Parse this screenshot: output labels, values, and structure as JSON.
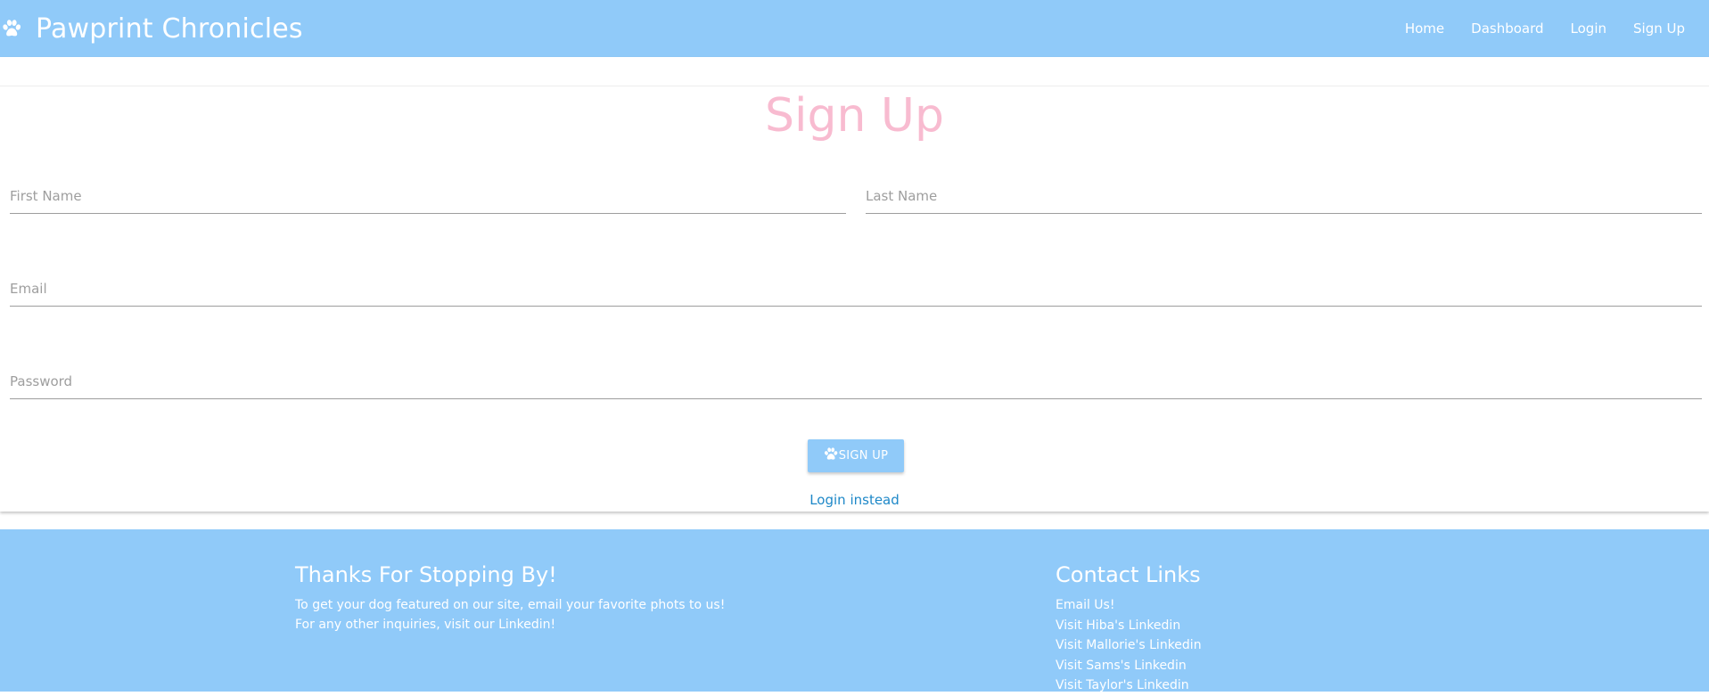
{
  "navbar": {
    "brand_icon": "paw-icon",
    "brand_title": "Pawprint Chronicles",
    "links": [
      {
        "label": "Home"
      },
      {
        "label": "Dashboard"
      },
      {
        "label": "Login"
      },
      {
        "label": "Sign Up"
      }
    ]
  },
  "form": {
    "title": "Sign Up",
    "first_name": {
      "placeholder": "First Name",
      "value": ""
    },
    "last_name": {
      "placeholder": "Last Name",
      "value": ""
    },
    "email": {
      "placeholder": "Email",
      "value": ""
    },
    "password": {
      "placeholder": "Password",
      "value": ""
    },
    "submit_icon": "paw-icon",
    "submit_label": "SIGN UP",
    "alt_link": "Login instead"
  },
  "footer": {
    "left": {
      "heading": "Thanks For Stopping By!",
      "lines": [
        "To get your dog featured on our site, email your favorite phots to us!",
        "For any other inquiries, visit our Linkedin!"
      ]
    },
    "right": {
      "heading": "Contact Links",
      "links": [
        "Email Us!",
        "Visit Hiba's Linkedin",
        "Visit Mallorie's Linkedin",
        "Visit Sams's Linkedin",
        "Visit Taylor's Linkedin"
      ]
    }
  },
  "colors": {
    "primary": "#90caf9",
    "title_pink": "#f8bbd0",
    "link_blue": "#1e88c8",
    "underline_grey": "#9e9e9e"
  }
}
